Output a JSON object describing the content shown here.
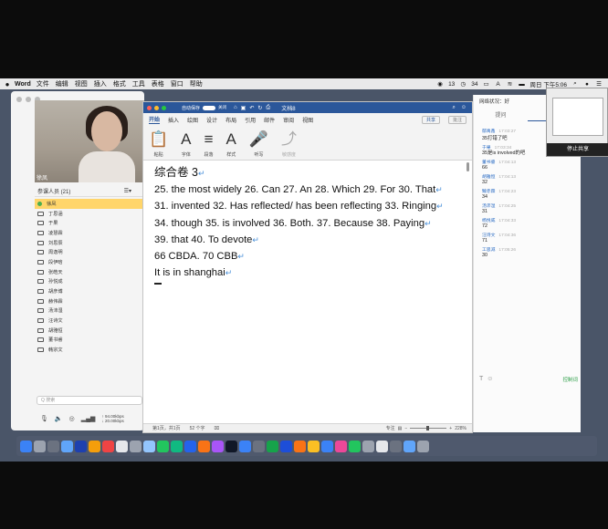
{
  "menubar": {
    "apple": "",
    "app": "Word",
    "items": [
      "文件",
      "编辑",
      "视图",
      "插入",
      "格式",
      "工具",
      "表格",
      "窗口",
      "帮助"
    ],
    "status": [
      "13",
      "34",
      "周日 下午5:06"
    ]
  },
  "meeting": {
    "video_name": "徐凤",
    "participants_title": "参课人员 (21)",
    "participants_menu": "☰▾",
    "participants": [
      "徐凤",
      "丁思涵",
      "于果",
      "凌慧霖",
      "刘思辰",
      "周逸明",
      "段伊晗",
      "张皓天",
      "孙悦成",
      "胡彦博",
      "赫伟霖",
      "汤沛湿",
      "汪诗文",
      "胡雅恒",
      "董书睿",
      "韩宗文"
    ],
    "search_placeholder": "Q 搜索",
    "speed_up": "↑ 94.00kbps",
    "speed_down": "↓ 20.00kbps"
  },
  "word": {
    "autosave": "自动保存",
    "autosave_state": "关闭",
    "doc_title": "文档8",
    "tabs": [
      "开始",
      "插入",
      "绘图",
      "设计",
      "布局",
      "引用",
      "邮件",
      "审阅",
      "视图"
    ],
    "share": "共享",
    "comment": "批注",
    "ribbon": [
      {
        "icon": "📋",
        "label": "粘贴"
      },
      {
        "icon": "A",
        "label": "字体"
      },
      {
        "icon": "≡",
        "label": "段落"
      },
      {
        "icon": "A",
        "label": "样式"
      },
      {
        "icon": "🎤",
        "label": "听写"
      },
      {
        "icon": "⤴",
        "label": "敏感度"
      }
    ],
    "lines": [
      "综合卷 3",
      "25. the most widely 26. Can 27. An 28. Which 29. For 30. That",
      "31. invented 32. Has reflected/ has been reflecting 33. Ringing",
      "34. though 35. is involved 36. Both. 37. Because 38. Paying",
      "39. that 40. To devote",
      "66 CBDA. 70 CBB",
      "It is in shanghai"
    ],
    "status_page": "第1页，共1页",
    "status_words": "52 个字",
    "status_focus": "专注",
    "status_zoom": "228%"
  },
  "chat": {
    "network": "网络状况：好",
    "tabs": [
      "提问",
      "公聊"
    ],
    "messages": [
      {
        "who": "郁禹鑫",
        "time": "17:03:27",
        "text": ""
      },
      {
        "who": "",
        "time": "",
        "text": "35打错了吧"
      },
      {
        "who": "于果",
        "time": "17:03:34",
        "text": "35是is involved的吧"
      },
      {
        "who": "董书睿",
        "time": "17:04:13",
        "text": "66"
      },
      {
        "who": "胡雅恒",
        "time": "17:04:13",
        "text": "32"
      },
      {
        "who": "臻赤霖",
        "time": "17:04:23",
        "text": "34"
      },
      {
        "who": "汤沛湿",
        "time": "17:04:25",
        "text": "31"
      },
      {
        "who": "杨悦威",
        "time": "17:04:33",
        "text": "72"
      },
      {
        "who": "汪诗文",
        "time": "17:04:36",
        "text": "71"
      },
      {
        "who": "工思减",
        "time": "17:05:26",
        "text": "30"
      }
    ],
    "send": "控制词"
  },
  "share": {
    "stop": "停止共享"
  },
  "colors": {
    "word_blue": "#2b579a",
    "highlight": "#ffd56a"
  }
}
